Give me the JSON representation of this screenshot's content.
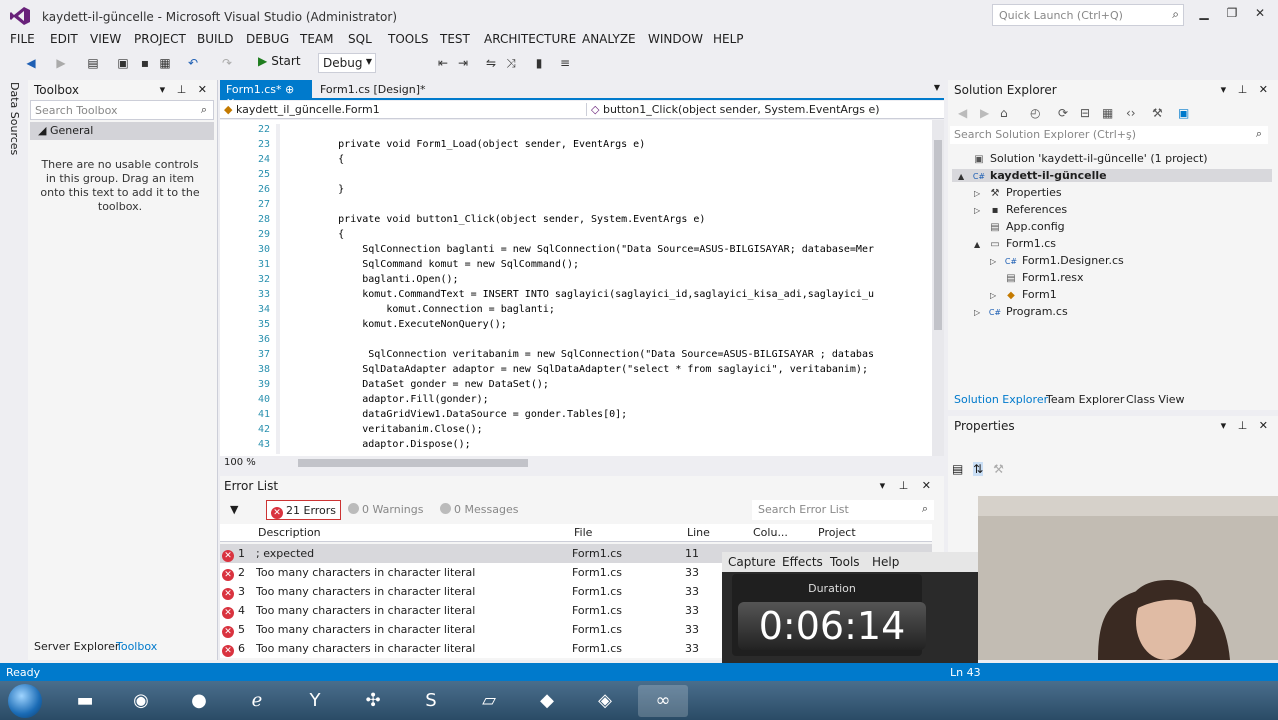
{
  "window": {
    "title": "kaydett-il-güncelle - Microsoft Visual Studio (Administrator)",
    "quick_launch_placeholder": "Quick Launch (Ctrl+Q)"
  },
  "menu": [
    "FILE",
    "EDIT",
    "VIEW",
    "PROJECT",
    "BUILD",
    "DEBUG",
    "TEAM",
    "SQL",
    "TOOLS",
    "TEST",
    "ARCHITECTURE",
    "ANALYZE",
    "WINDOW",
    "HELP"
  ],
  "toolbar": {
    "start_label": "Start",
    "config_value": "Debug"
  },
  "left_strip_label": "Data Sources",
  "toolbox": {
    "title": "Toolbox",
    "search_placeholder": "Search Toolbox",
    "group": "General",
    "empty_message": "There are no usable controls in this group. Drag an item onto this text to add it to the toolbox.",
    "bottom_tabs": [
      "Server Explorer",
      "Toolbox"
    ]
  },
  "editor": {
    "tabs": [
      "Form1.cs*",
      "Form1.cs [Design]*"
    ],
    "nav_left": "kaydett_il_güncelle.Form1",
    "nav_right": "button1_Click(object sender, System.EventArgs e)",
    "zoom": "100 %",
    "lines": [
      {
        "n": "22",
        "code": ""
      },
      {
        "n": "23",
        "code": "        private void Form1_Load(object sender, EventArgs e)"
      },
      {
        "n": "24",
        "code": "        {"
      },
      {
        "n": "25",
        "code": ""
      },
      {
        "n": "26",
        "code": "        }"
      },
      {
        "n": "27",
        "code": ""
      },
      {
        "n": "28",
        "code": "        private void button1_Click(object sender, System.EventArgs e)"
      },
      {
        "n": "29",
        "code": "        {"
      },
      {
        "n": "30",
        "code": "            SqlConnection baglanti = new SqlConnection(\"Data Source=ASUS-BILGISAYAR; database=Mer"
      },
      {
        "n": "31",
        "code": "            SqlCommand komut = new SqlCommand();"
      },
      {
        "n": "32",
        "code": "            baglanti.Open();"
      },
      {
        "n": "33",
        "code": "            komut.CommandText = INSERT INTO saglayici(saglayici_id,saglayici_kisa_adi,saglayici_u"
      },
      {
        "n": "34",
        "code": "                komut.Connection = baglanti;"
      },
      {
        "n": "35",
        "code": "            komut.ExecuteNonQuery();"
      },
      {
        "n": "36",
        "code": ""
      },
      {
        "n": "37",
        "code": "             SqlConnection veritabanim = new SqlConnection(\"Data Source=ASUS-BILGISAYAR ; databas"
      },
      {
        "n": "38",
        "code": "            SqlDataAdapter adaptor = new SqlDataAdapter(\"select * from saglayici\", veritabanim);"
      },
      {
        "n": "39",
        "code": "            DataSet gonder = new DataSet();"
      },
      {
        "n": "40",
        "code": "            adaptor.Fill(gonder);"
      },
      {
        "n": "41",
        "code": "            dataGridView1.DataSource = gonder.Tables[0];"
      },
      {
        "n": "42",
        "code": "            veritabanim.Close();"
      },
      {
        "n": "43",
        "code": "            adaptor.Dispose();"
      }
    ]
  },
  "error_list": {
    "title": "Error List",
    "errors_chip": "21 Errors",
    "warnings_chip": "0 Warnings",
    "messages_chip": "0 Messages",
    "search_placeholder": "Search Error List",
    "columns": [
      "Description",
      "File",
      "Line",
      "Colu...",
      "Project"
    ],
    "rows": [
      {
        "n": "1",
        "desc": "; expected",
        "file": "Form1.cs",
        "line": "11"
      },
      {
        "n": "2",
        "desc": "Too many characters in character literal",
        "file": "Form1.cs",
        "line": "33"
      },
      {
        "n": "3",
        "desc": "Too many characters in character literal",
        "file": "Form1.cs",
        "line": "33"
      },
      {
        "n": "4",
        "desc": "Too many characters in character literal",
        "file": "Form1.cs",
        "line": "33"
      },
      {
        "n": "5",
        "desc": "Too many characters in character literal",
        "file": "Form1.cs",
        "line": "33"
      },
      {
        "n": "6",
        "desc": "Too many characters in character literal",
        "file": "Form1.cs",
        "line": "33"
      }
    ]
  },
  "solution_explorer": {
    "title": "Solution Explorer",
    "search_placeholder": "Search Solution Explorer (Ctrl+ş)",
    "tree": [
      {
        "label": "Solution 'kaydett-il-güncelle' (1 project)",
        "depth": 0,
        "arrow": "",
        "icon": "solution"
      },
      {
        "label": "kaydett-il-güncelle",
        "depth": 0,
        "arrow": "▲",
        "icon": "project"
      },
      {
        "label": "Properties",
        "depth": 1,
        "arrow": "▷",
        "icon": "wrench"
      },
      {
        "label": "References",
        "depth": 1,
        "arrow": "▷",
        "icon": "references"
      },
      {
        "label": "App.config",
        "depth": 1,
        "arrow": "",
        "icon": "config"
      },
      {
        "label": "Form1.cs",
        "depth": 1,
        "arrow": "▲",
        "icon": "form"
      },
      {
        "label": "Form1.Designer.cs",
        "depth": 2,
        "arrow": "▷",
        "icon": "csfile"
      },
      {
        "label": "Form1.resx",
        "depth": 2,
        "arrow": "",
        "icon": "resx"
      },
      {
        "label": "Form1",
        "depth": 2,
        "arrow": "▷",
        "icon": "class"
      },
      {
        "label": "Program.cs",
        "depth": 1,
        "arrow": "▷",
        "icon": "csfile"
      }
    ],
    "tabs": [
      "Solution Explorer",
      "Team Explorer",
      "Class View"
    ]
  },
  "properties": {
    "title": "Properties"
  },
  "capture": {
    "menu": [
      "Capture",
      "Effects",
      "Tools",
      "Help"
    ],
    "duration_label": "Duration",
    "timer": "0:06:14"
  },
  "status": {
    "ready": "Ready",
    "position": "Ln 43"
  }
}
